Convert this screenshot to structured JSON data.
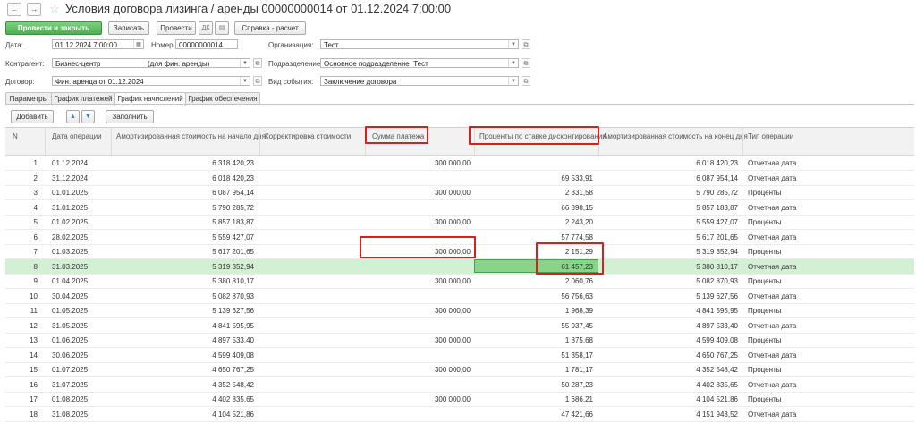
{
  "window": {
    "title": "Условия договора лизинга / аренды 00000000014 от 01.12.2024 7:00:00"
  },
  "toolbar": {
    "post_close": "Провести и закрыть",
    "save": "Записать",
    "post": "Провести",
    "dt_kt": "Дт Кт",
    "help_calc": "Справка - расчет"
  },
  "form": {
    "date_label": "Дата:",
    "date_value": "01.12.2024  7:00:00",
    "number_label": "Номер:",
    "number_value": "00000000014",
    "org_label": "Организация:",
    "org_value": "Тест",
    "counterparty_label": "Контрагент:",
    "counterparty_value": "Бизнес-центр",
    "counterparty_suffix": "(для фин. аренды)",
    "division_label": "Подразделение:",
    "division_value": "Основное подразделение_Тест",
    "contract_label": "Договор:",
    "contract_value": "Фин. аренда от 01.12.2024",
    "event_label": "Вид события:",
    "event_value": "Заключение договора"
  },
  "tabs": [
    "Параметры",
    "График платежей",
    "График начислений",
    "График обеспечения"
  ],
  "table_toolbar": {
    "add": "Добавить",
    "fill": "Заполнить"
  },
  "columns": {
    "n": "N",
    "date": "Дата операции",
    "amort_start": "Амортизированная стоимость на начало дня",
    "adjust": "Корректировка стоимости",
    "payment": "Сумма платежа",
    "interest": "Проценты по ставке дисконтирования",
    "amort_end": "Амортизированная стоимость на конец дня",
    "op_type": "Тип операции"
  },
  "rows": [
    {
      "n": "1",
      "date": "01.12.2024",
      "start": "6 318 420,23",
      "adj": "",
      "pay": "300 000,00",
      "int": "",
      "end": "6 018 420,23",
      "type": "Отчетная дата"
    },
    {
      "n": "2",
      "date": "31.12.2024",
      "start": "6 018 420,23",
      "adj": "",
      "pay": "",
      "int": "69 533,91",
      "end": "6 087 954,14",
      "type": "Отчетная дата"
    },
    {
      "n": "3",
      "date": "01.01.2025",
      "start": "6 087 954,14",
      "adj": "",
      "pay": "300 000,00",
      "int": "2 331,58",
      "end": "5 790 285,72",
      "type": "Проценты"
    },
    {
      "n": "4",
      "date": "31.01.2025",
      "start": "5 790 285,72",
      "adj": "",
      "pay": "",
      "int": "66 898,15",
      "end": "5 857 183,87",
      "type": "Отчетная дата"
    },
    {
      "n": "5",
      "date": "01.02.2025",
      "start": "5 857 183,87",
      "adj": "",
      "pay": "300 000,00",
      "int": "2 243,20",
      "end": "5 559 427,07",
      "type": "Проценты"
    },
    {
      "n": "6",
      "date": "28.02.2025",
      "start": "5 559 427,07",
      "adj": "",
      "pay": "",
      "int": "57 774,58",
      "end": "5 617 201,65",
      "type": "Отчетная дата"
    },
    {
      "n": "7",
      "date": "01.03.2025",
      "start": "5 617 201,65",
      "adj": "",
      "pay": "300 000,00",
      "int": "2 151,29",
      "end": "5 319 352,94",
      "type": "Проценты"
    },
    {
      "n": "8",
      "date": "31.03.2025",
      "start": "5 319 352,94",
      "adj": "",
      "pay": "",
      "int": "61 457,23",
      "end": "5 380 810,17",
      "type": "Отчетная дата"
    },
    {
      "n": "9",
      "date": "01.04.2025",
      "start": "5 380 810,17",
      "adj": "",
      "pay": "300 000,00",
      "int": "2 060,76",
      "end": "5 082 870,93",
      "type": "Проценты"
    },
    {
      "n": "10",
      "date": "30.04.2025",
      "start": "5 082 870,93",
      "adj": "",
      "pay": "",
      "int": "56 756,63",
      "end": "5 139 627,56",
      "type": "Отчетная дата"
    },
    {
      "n": "11",
      "date": "01.05.2025",
      "start": "5 139 627,56",
      "adj": "",
      "pay": "300 000,00",
      "int": "1 968,39",
      "end": "4 841 595,95",
      "type": "Проценты"
    },
    {
      "n": "12",
      "date": "31.05.2025",
      "start": "4 841 595,95",
      "adj": "",
      "pay": "",
      "int": "55 937,45",
      "end": "4 897 533,40",
      "type": "Отчетная дата"
    },
    {
      "n": "13",
      "date": "01.06.2025",
      "start": "4 897 533,40",
      "adj": "",
      "pay": "300 000,00",
      "int": "1 875,68",
      "end": "4 599 409,08",
      "type": "Проценты"
    },
    {
      "n": "14",
      "date": "30.06.2025",
      "start": "4 599 409,08",
      "adj": "",
      "pay": "",
      "int": "51 358,17",
      "end": "4 650 767,25",
      "type": "Отчетная дата"
    },
    {
      "n": "15",
      "date": "01.07.2025",
      "start": "4 650 767,25",
      "adj": "",
      "pay": "300 000,00",
      "int": "1 781,17",
      "end": "4 352 548,42",
      "type": "Проценты"
    },
    {
      "n": "16",
      "date": "31.07.2025",
      "start": "4 352 548,42",
      "adj": "",
      "pay": "",
      "int": "50 287,23",
      "end": "4 402 835,65",
      "type": "Отчетная дата"
    },
    {
      "n": "17",
      "date": "01.08.2025",
      "start": "4 402 835,65",
      "adj": "",
      "pay": "300 000,00",
      "int": "1 686,21",
      "end": "4 104 521,86",
      "type": "Проценты"
    },
    {
      "n": "18",
      "date": "31.08.2025",
      "start": "4 104 521,86",
      "adj": "",
      "pay": "",
      "int": "47 421,66",
      "end": "4 151 943,52",
      "type": "Отчетная дата"
    }
  ],
  "selected_row": 8,
  "colors": {
    "accent_green": "#4caf50",
    "selection": "#d4f0d4",
    "annotation_red": "#d42020"
  }
}
